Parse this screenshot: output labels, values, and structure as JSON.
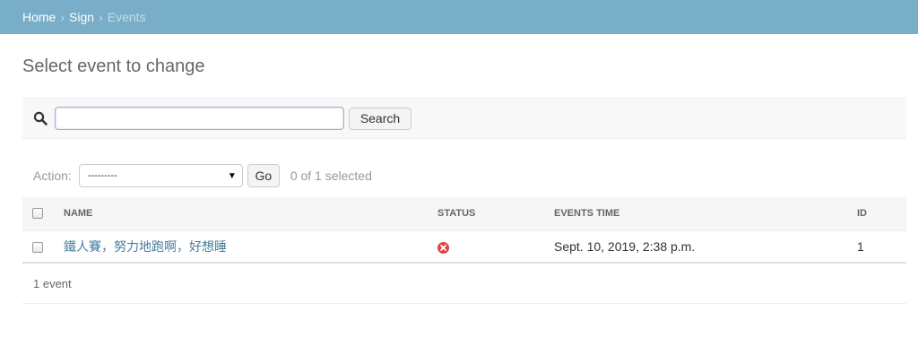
{
  "breadcrumbs": {
    "home": "Home",
    "sep1": "›",
    "app": "Sign",
    "sep2": "›",
    "current": "Events"
  },
  "page_title": "Select event to change",
  "search": {
    "icon": "search-icon",
    "value": "",
    "button_label": "Search"
  },
  "actions": {
    "label": "Action:",
    "selected_option": "---------",
    "go_label": "Go",
    "selected_count": "0 of 1 selected"
  },
  "table": {
    "headers": {
      "name": "NAME",
      "status": "STATUS",
      "events_time": "EVENTS TIME",
      "id": "ID"
    },
    "rows": [
      {
        "name": "鐵人賽，努力地跑啊，好想睡",
        "status": "false",
        "status_icon": "icon-no",
        "events_time": "Sept. 10, 2019, 2:38 p.m.",
        "id": "1"
      }
    ]
  },
  "paginator": {
    "text": "1 event"
  },
  "colors": {
    "header_bar": "#79aec8",
    "link": "#447e9b",
    "status_no": "#dd4646"
  }
}
